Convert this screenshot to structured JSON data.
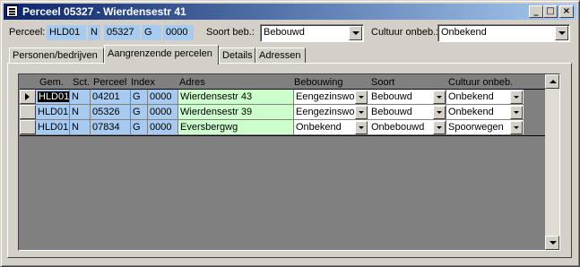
{
  "window": {
    "title": "Perceel 05327 - Wierdensestr 41",
    "minimize_glyph": "_",
    "maximize_glyph": "□",
    "close_glyph": "×"
  },
  "header": {
    "perceel_label": "Perceel:",
    "gem": "HLD01",
    "sectie": "N",
    "perceel": "05327",
    "index_letter": "G",
    "index_nr": "0000",
    "soort_label": "Soort beb.:",
    "soort_value": "Bebouwd",
    "cultuur_label": "Cultuur onbeb.:",
    "cultuur_value": "Onbekend"
  },
  "tabs": [
    {
      "label": "Personen/bedrijven"
    },
    {
      "label": "Aangrenzende percelen"
    },
    {
      "label": "Details"
    },
    {
      "label": "Adressen"
    }
  ],
  "grid": {
    "columns": [
      "Gem.",
      "Sct.",
      "Perceel",
      "Index",
      "Adres",
      "Bebouwing",
      "Soort",
      "Cultuur onbeb."
    ],
    "rows": [
      {
        "gem": "HLD01",
        "sct": "N",
        "perceel": "04201",
        "index_letter": "G",
        "index_nr": "0000",
        "adres": "Wierdensestr 43",
        "bebouwing": "Eengezinswor",
        "soort": "Bebouwd",
        "cultuur": "Onbekend"
      },
      {
        "gem": "HLD01",
        "sct": "N",
        "perceel": "05326",
        "index_letter": "G",
        "index_nr": "0000",
        "adres": "Wierdensestr 39",
        "bebouwing": "Eengezinswor",
        "soort": "Bebouwd",
        "cultuur": "Onbekend"
      },
      {
        "gem": "HLD01",
        "sct": "N",
        "perceel": "07834",
        "index_letter": "G",
        "index_nr": "0000",
        "adres": "Eversbergwg",
        "bebouwing": "Onbekend",
        "soort": "Onbebouwd",
        "cultuur": "Spoorwegen"
      }
    ]
  },
  "colors": {
    "title_start": "#0a246a",
    "title_end": "#a6caf0",
    "key_field": "#a6caf0",
    "address_field": "#ccffcc",
    "face": "#d4d0c8"
  }
}
